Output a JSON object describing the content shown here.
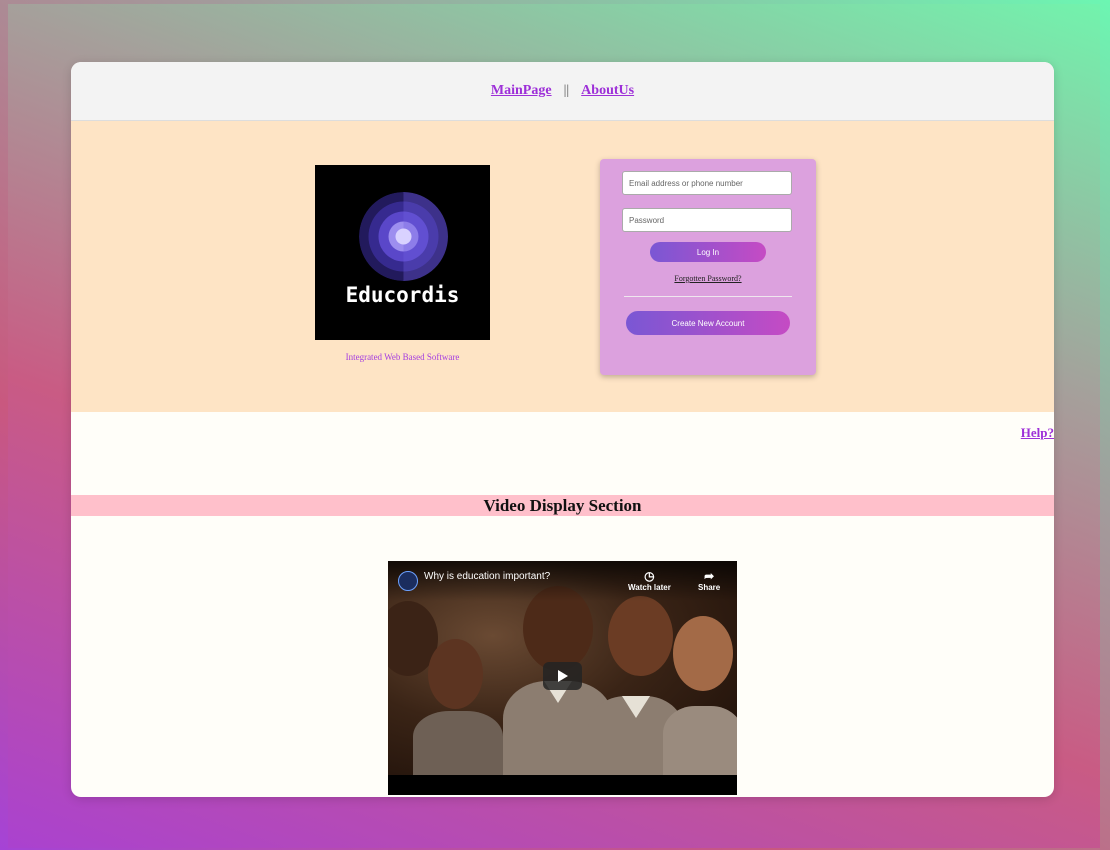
{
  "nav": {
    "main_page": "MainPage",
    "separator": "||",
    "about_us": "AboutUs"
  },
  "logo": {
    "text": "Educordis",
    "tagline": "Integrated Web Based Software"
  },
  "login": {
    "email_placeholder": "Email address or phone number",
    "password_placeholder": "Password",
    "login_button": "Log In",
    "forgot_password": "Forgotten Password?",
    "create_account": "Create New Account"
  },
  "help_link": "Help?",
  "video_section": {
    "title": "Video Display Section",
    "video_title": "Why is education important?",
    "watch_later": "Watch later",
    "share": "Share",
    "watch_later_icon": "clock-icon",
    "share_icon": "share-icon"
  },
  "colors": {
    "accent": "#9d2fd8",
    "hero_bg": "#fee4c5",
    "login_bg": "#dca1de",
    "section_bar": "#ffc0cb"
  }
}
